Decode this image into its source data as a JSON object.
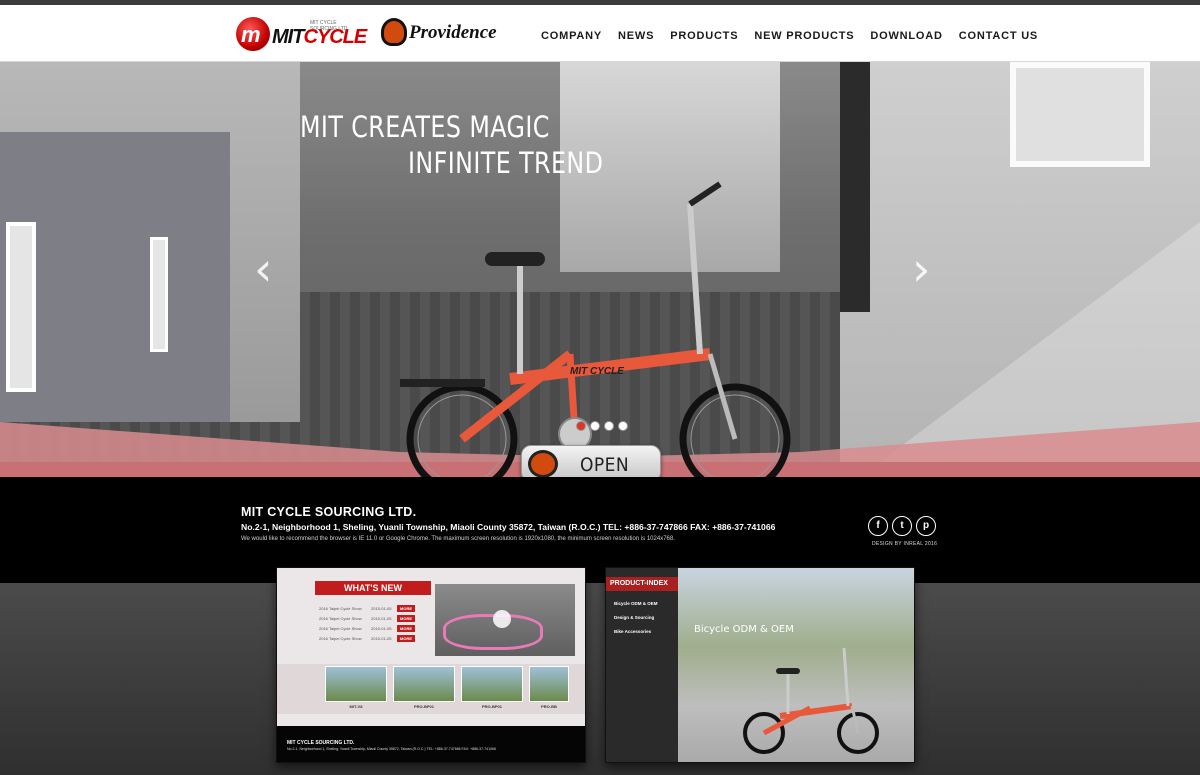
{
  "brand": {
    "mit_logo_mark": "m",
    "mit_logo_word1": "MIT",
    "mit_logo_word2": "CYCLE",
    "mit_logo_small": "MIT CYCLE SOURCING LTD.",
    "providence_logo": "Providence"
  },
  "nav": [
    "COMPANY",
    "NEWS",
    "PRODUCTS",
    "NEW PRODUCTS",
    "DOWNLOAD",
    "CONTACT US"
  ],
  "hero": {
    "line1": "MIT CREATES MAGIC",
    "line2": "INFINITE TREND",
    "prev_arrow": "‹",
    "next_arrow": "›",
    "slides": 4,
    "active_slide": 1,
    "bike_color": "#e8583a"
  },
  "open_button": {
    "label": "OPEN"
  },
  "footer": {
    "company": "MIT CYCLE SOURCING LTD.",
    "address": "No.2-1, Neighborhood 1, Sheling, Yuanli Township, Miaoli County 35872, Taiwan (R.O.C.) TEL: +886-37-747866 FAX: +886-37-741066",
    "note": "We would like to recommend the browser is IE 11.0 or Google Chrome. The maximum screen resolution is 1920x1080, the minimum screen resolution is 1024x768.",
    "social": [
      "f",
      "t",
      "p"
    ],
    "credit": "DESIGN BY INREAL 2016"
  },
  "preview_news": {
    "title": "WHAT'S NEW",
    "items": [
      {
        "title": "2016 Taipei Cycle Show",
        "date": "2015-01-05",
        "more": "MORE"
      },
      {
        "title": "2016 Taipei Cycle Show",
        "date": "2015-01-05",
        "more": "MORE"
      },
      {
        "title": "2016 Taipei Cycle Show",
        "date": "2015-01-05",
        "more": "MORE"
      },
      {
        "title": "2016 Taipei Cycle Show",
        "date": "2015-01-05",
        "more": "MORE"
      }
    ],
    "thumbs": [
      "MIT-V8",
      "PRO-BP01",
      "PRO-BP01",
      "PRO-BB"
    ],
    "footer_company": "MIT CYCLE SOURCING LTD.",
    "footer_address": "No.2-1, Neighborhood 1, Sheling, Yuanli Township, Miaoli County 35872, Taiwan (R.O.C.) TEL: +886-37-747866 FAX: +886-37-741066"
  },
  "preview_index": {
    "title": "PRODUCT-INDEX",
    "items": [
      "Bicycle ODM & OEM",
      "Design & Sourcing",
      "Bike Accessories"
    ],
    "caption": "Bicycle ODM & OEM"
  },
  "colors": {
    "accent_red": "#c21d1d",
    "brand_orange": "#d24a0e",
    "footer_bg": "#000000"
  }
}
